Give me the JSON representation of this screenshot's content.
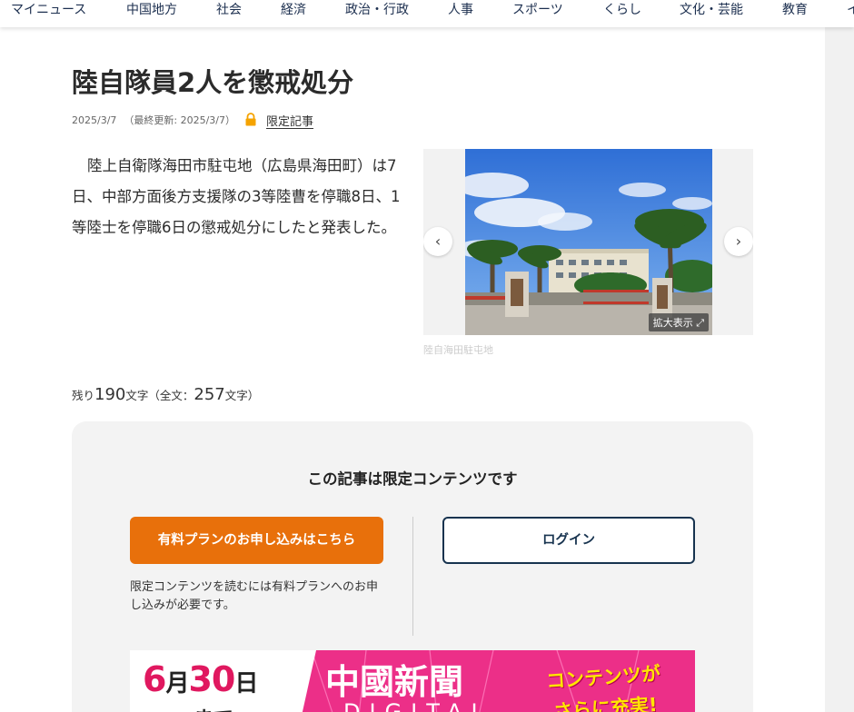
{
  "nav": {
    "items": [
      "マイニュース",
      "中国地方",
      "社会",
      "経済",
      "政治・行政",
      "人事",
      "スポーツ",
      "くらし",
      "文化・芸能",
      "教育",
      "イ"
    ]
  },
  "article": {
    "title": "陸自隊員2人を懲戒処分",
    "date": "2025/3/7",
    "updated": "（最終更新: 2025/3/7）",
    "limited_label": "限定記事",
    "body": "陸上自衛隊海田市駐屯地（広島県海田町）は7日、中部方面後方支援隊の3等陸曹を停職8日、1等陸士を停職6日の懲戒処分にしたと発表した。",
    "photo": {
      "caption": "陸自海田駐屯地",
      "zoom_label": "拡大表示 ⤢",
      "prev_icon": "‹",
      "next_icon": "›"
    },
    "remain": {
      "prefix": "残り",
      "remaining": "190",
      "mid": "文字（全文：",
      "total": "257",
      "suffix": "文字）"
    }
  },
  "paywall": {
    "title": "この記事は限定コンテンツです",
    "paid_button": "有料プランのお申し込みはこちら",
    "note": "限定コンテンツを読むには有料プランへのお申し込みが必要です。",
    "login_button": "ログイン"
  },
  "banner": {
    "date_num1": "6",
    "date_unit1": "月",
    "date_num2": "30",
    "date_unit2": "日",
    "made": "まで",
    "logo": "中國新聞",
    "digital": "DIGITAL",
    "tag1": "コンテンツが",
    "tag2": "さらに充実!"
  },
  "colors": {
    "accent": "#e8700b",
    "navy": "#17334f",
    "banner_pink": "#ec2f88",
    "lock": "#f5a300"
  }
}
